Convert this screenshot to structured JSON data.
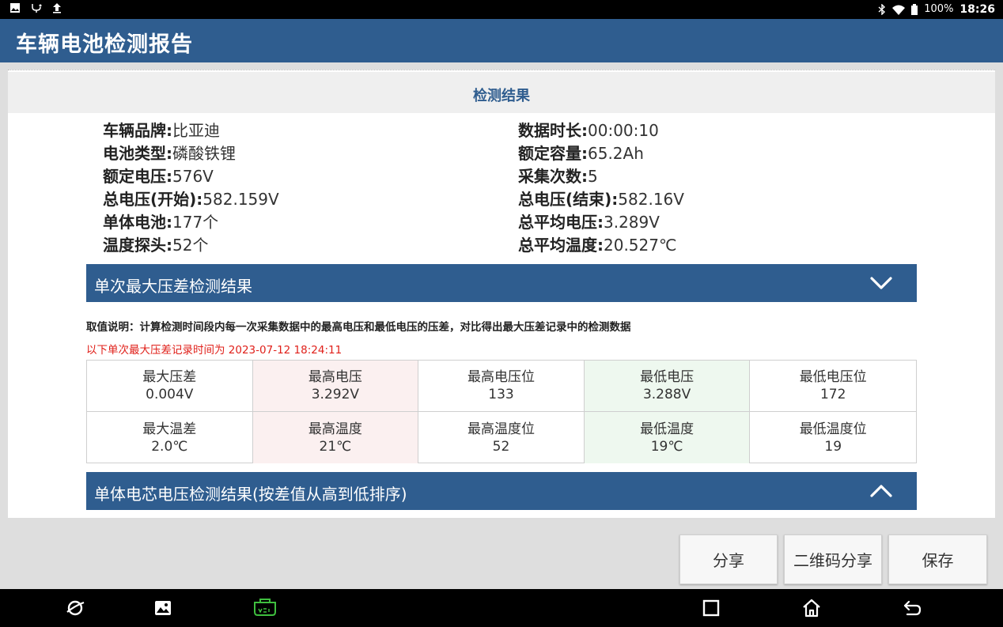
{
  "statusbar": {
    "battery_percent": "100%",
    "time": "18:26"
  },
  "app": {
    "title": "车辆电池检测报告"
  },
  "panel": {
    "header": "检测结果"
  },
  "info": {
    "left": [
      {
        "label": "车辆品牌:",
        "value": "比亚迪"
      },
      {
        "label": "电池类型:",
        "value": "磷酸铁锂"
      },
      {
        "label": "额定电压:",
        "value": "576V"
      },
      {
        "label": "总电压(开始):",
        "value": "582.159V"
      },
      {
        "label": "单体电池:",
        "value": "177个"
      },
      {
        "label": "温度探头:",
        "value": "52个"
      }
    ],
    "right": [
      {
        "label": "数据时长:",
        "value": "00:00:10"
      },
      {
        "label": "额定容量:",
        "value": "65.2Ah"
      },
      {
        "label": "采集次数:",
        "value": "5"
      },
      {
        "label": "总电压(结束):",
        "value": "582.16V"
      },
      {
        "label": "总平均电压:",
        "value": "3.289V"
      },
      {
        "label": "总平均温度:",
        "value": "20.527℃"
      }
    ]
  },
  "section1": {
    "title": "单次最大压差检测结果",
    "chevron_icon": "chevron-down-icon"
  },
  "notes": {
    "description": "取值说明：计算检测时间段内每一次采集数据中的最高电压和最低电压的压差，对比得出最大压差记录中的检测数据",
    "record_time": "以下单次最大压差记录时间为 2023-07-12 18:24:11"
  },
  "grid": {
    "cells": [
      {
        "label": "最大压差",
        "value": "0.004V"
      },
      {
        "label": "最高电压",
        "value": "3.292V"
      },
      {
        "label": "最高电压位",
        "value": "133"
      },
      {
        "label": "最低电压",
        "value": "3.288V"
      },
      {
        "label": "最低电压位",
        "value": "172"
      },
      {
        "label": "最大温差",
        "value": "2.0℃"
      },
      {
        "label": "最高温度",
        "value": "21℃"
      },
      {
        "label": "最高温度位",
        "value": "52"
      },
      {
        "label": "最低温度",
        "value": "19℃"
      },
      {
        "label": "最低温度位",
        "value": "19"
      }
    ]
  },
  "section2": {
    "title": "单体电芯电压检测结果(按差值从高到低排序)",
    "chevron_icon": "chevron-up-icon"
  },
  "buttons": {
    "share": "分享",
    "qr_share": "二维码分享",
    "save": "保存"
  },
  "colors": {
    "primary": "#2f5d8f",
    "accent_red": "#e0201a",
    "cell_red": "#fbf0f0",
    "cell_green": "#eef8ef",
    "vci_green": "#3fbf3f"
  }
}
